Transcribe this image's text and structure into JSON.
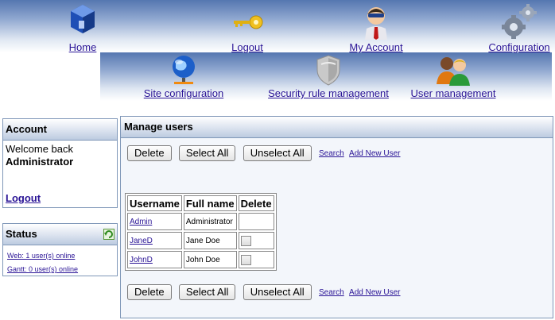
{
  "nav": {
    "home": "Home",
    "logout": "Logout",
    "my_account": "My Account",
    "configuration": "Configuration",
    "site_configuration": "Site configuration",
    "security_rule_management": "Security rule management",
    "user_management": "User management"
  },
  "account": {
    "title": "Account",
    "welcome": "Welcome back",
    "user": "Administrator",
    "logout": "Logout"
  },
  "status": {
    "title": "Status",
    "web": "Web: 1 user(s) online",
    "gantt": "Gantt: 0 user(s) online"
  },
  "manage": {
    "title": "Manage users",
    "delete": "Delete",
    "select_all": "Select All",
    "unselect_all": "Unselect All",
    "search": "Search",
    "add_new_user": "Add New User",
    "columns": [
      "Username",
      "Full name",
      "Delete"
    ],
    "rows": [
      {
        "username": "Admin",
        "fullname": "Administrator"
      },
      {
        "username": "JaneD",
        "fullname": "Jane Doe"
      },
      {
        "username": "JohnD",
        "fullname": "John Doe"
      }
    ]
  }
}
